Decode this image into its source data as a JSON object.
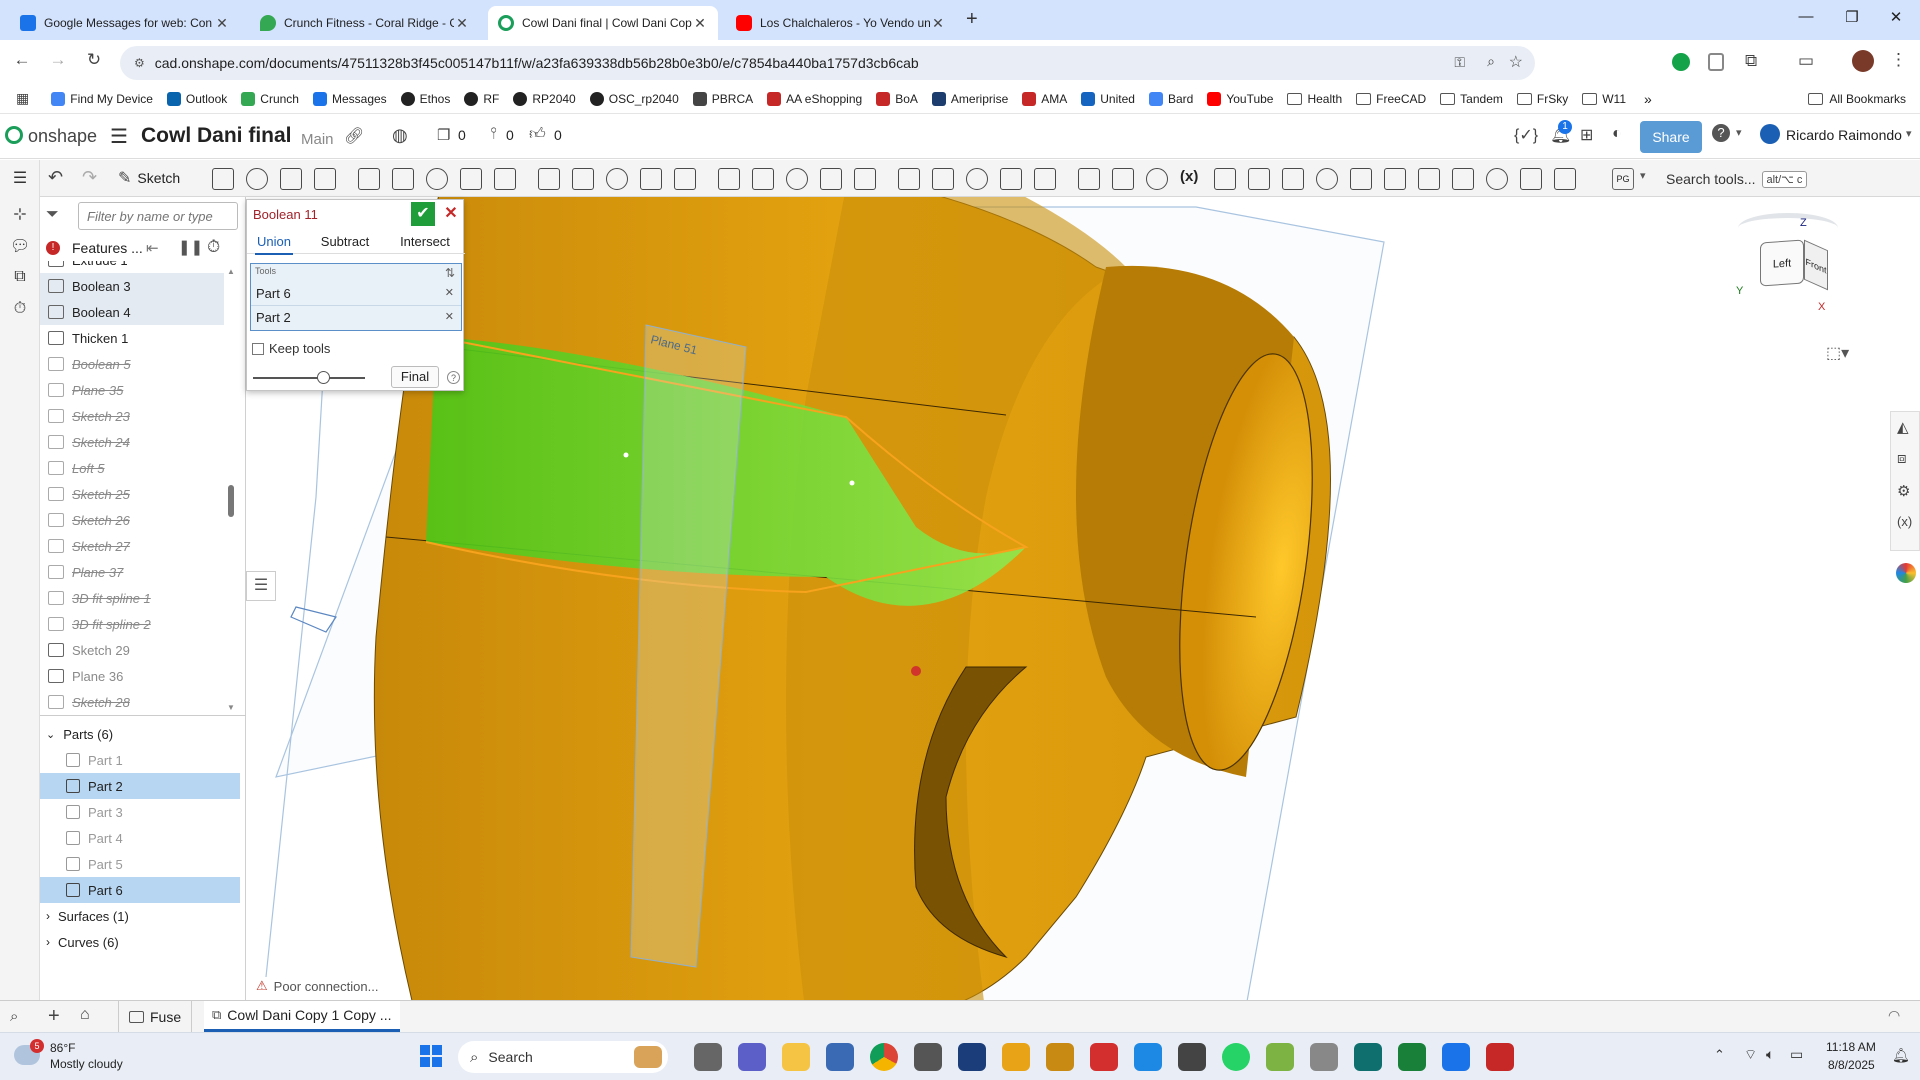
{
  "browser": {
    "tabs": [
      {
        "title": "Google Messages for web: Con",
        "color": "#1a73e8"
      },
      {
        "title": "Crunch Fitness - Coral Ridge - G",
        "color": "#34a853"
      },
      {
        "title": "Cowl Dani final | Cowl Dani Cop",
        "color": "#1b9e5a"
      },
      {
        "title": "Los Chalchaleros - Yo Vendo un",
        "color": "#ff0000"
      }
    ],
    "new_tab": "+",
    "url": "cad.onshape.com/documents/47511328b3f45c005147b11f/w/a23fa639338db56b28b0e3b0/e/c7854ba440ba1757d3cb6cab",
    "bookmarks": [
      {
        "label": "Find My Device",
        "icon": "google-icon"
      },
      {
        "label": "Outlook",
        "icon": "outlook-icon"
      },
      {
        "label": "Crunch",
        "icon": "maps-icon"
      },
      {
        "label": "Messages",
        "icon": "messages-icon"
      },
      {
        "label": "Ethos",
        "icon": "github-icon"
      },
      {
        "label": "RF",
        "icon": "github-icon"
      },
      {
        "label": "RP2040",
        "icon": "github-icon"
      },
      {
        "label": "OSC_rp2040",
        "icon": "github-icon"
      },
      {
        "label": "PBRCA",
        "icon": "globe-icon"
      },
      {
        "label": "AA eShopping",
        "icon": "aa-icon"
      },
      {
        "label": "BoA",
        "icon": "boa-icon"
      },
      {
        "label": "Ameriprise",
        "icon": "ameriprise-icon"
      },
      {
        "label": "AMA",
        "icon": "ama-icon"
      },
      {
        "label": "United",
        "icon": "united-icon"
      },
      {
        "label": "Bard",
        "icon": "bard-icon"
      },
      {
        "label": "YouTube",
        "icon": "youtube-icon"
      },
      {
        "label": "Health",
        "icon": "folder-icon"
      },
      {
        "label": "FreeCAD",
        "icon": "folder-icon"
      },
      {
        "label": "Tandem",
        "icon": "folder-icon"
      },
      {
        "label": "FrSky",
        "icon": "folder-icon"
      },
      {
        "label": "W11",
        "icon": "folder-icon"
      }
    ],
    "more": "»",
    "all_bookmarks": "All Bookmarks"
  },
  "onshape": {
    "logo": "onshape",
    "doc_title": "Cowl Dani final",
    "branch": "Main",
    "versions_count": "0",
    "branches_count": "0",
    "likes_count": "0",
    "notification_badge": "1",
    "share_label": "Share",
    "user_name": "Ricardo Raimondo",
    "sketch_label": "Sketch",
    "search_tools": "Search tools...",
    "search_shortcut": "alt/⌥ c",
    "pg_label": "PG"
  },
  "feature_tree": {
    "filter_placeholder": "Filter by name or type",
    "features_label": "Features ...",
    "items": [
      {
        "label": "Extrude 1",
        "state": "normal"
      },
      {
        "label": "Boolean 3",
        "state": "selected"
      },
      {
        "label": "Boolean 4",
        "state": "selected"
      },
      {
        "label": "Thicken 1",
        "state": "normal"
      },
      {
        "label": "Boolean 5",
        "state": "suppressed"
      },
      {
        "label": "Plane 35",
        "state": "suppressed"
      },
      {
        "label": "Sketch 23",
        "state": "suppressed"
      },
      {
        "label": "Sketch 24",
        "state": "suppressed"
      },
      {
        "label": "Loft 5",
        "state": "suppressed"
      },
      {
        "label": "Sketch 25",
        "state": "suppressed"
      },
      {
        "label": "Sketch 26",
        "state": "suppressed"
      },
      {
        "label": "Sketch 27",
        "state": "suppressed"
      },
      {
        "label": "Plane 37",
        "state": "suppressed"
      },
      {
        "label": "3D fit spline 1",
        "state": "suppressed"
      },
      {
        "label": "3D fit spline 2",
        "state": "suppressed"
      },
      {
        "label": "Sketch 29",
        "state": "faded"
      },
      {
        "label": "Plane 36",
        "state": "faded"
      },
      {
        "label": "Sketch 28",
        "state": "suppressed"
      }
    ],
    "parts_header": "Parts (6)",
    "parts": [
      {
        "label": "Part 1",
        "selected": false
      },
      {
        "label": "Part 2",
        "selected": true
      },
      {
        "label": "Part 3",
        "selected": false
      },
      {
        "label": "Part 4",
        "selected": false
      },
      {
        "label": "Part 5",
        "selected": false
      },
      {
        "label": "Part 6",
        "selected": true
      }
    ],
    "surfaces_header": "Surfaces (1)",
    "curves_header": "Curves (6)"
  },
  "boolean_dialog": {
    "title": "Boolean 11",
    "tabs": [
      "Union",
      "Subtract",
      "Intersect"
    ],
    "active_tab": "Union",
    "tools_label": "Tools",
    "tools": [
      "Part 6",
      "Part 2"
    ],
    "keep_tools_label": "Keep tools",
    "final_label": "Final",
    "help": "?"
  },
  "viewport": {
    "plane_label": "Plane 51",
    "viewcube_left": "Left",
    "viewcube_front": "Front",
    "axis_x": "X",
    "axis_y": "Y",
    "axis_z": "Z",
    "status": "Poor connection...",
    "colors": {
      "body": "#e3a20f",
      "body_dark": "#a46e05",
      "selected": "#4cc617",
      "highlight": "#f7a31d"
    }
  },
  "bottom_tabs": {
    "folder": "Fuse",
    "active_tab": "Cowl Dani Copy 1 Copy ..."
  },
  "taskbar": {
    "weather_temp": "86°F",
    "weather_desc": "Mostly cloudy",
    "weather_badge": "5",
    "search_label": "Search",
    "time": "11:18 AM",
    "date": "8/8/2025"
  }
}
